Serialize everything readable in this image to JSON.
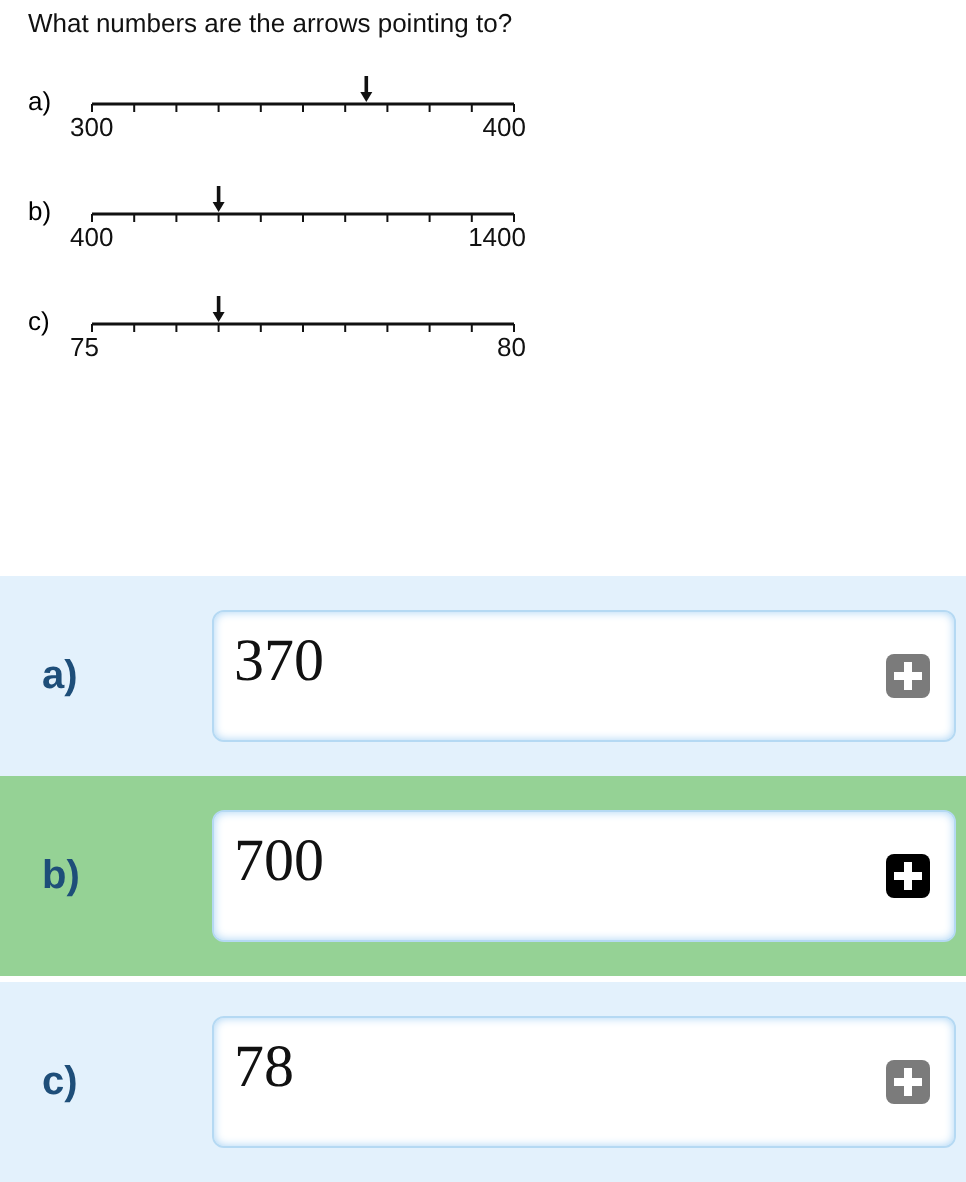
{
  "question": "What numbers are the arrows pointing to?",
  "number_lines": [
    {
      "label": "a)",
      "start": "300",
      "end": "400",
      "level": 0.65
    },
    {
      "label": "b)",
      "start": "400",
      "end": "1400",
      "level": 0.3
    },
    {
      "label": "c)",
      "start": "75",
      "end": "80",
      "level": 0.3
    }
  ],
  "answers": [
    {
      "label": "a)",
      "value": "370",
      "selected": false
    },
    {
      "label": "b)",
      "value": "700",
      "selected": true
    },
    {
      "label": "c)",
      "value": "78",
      "selected": false
    }
  ]
}
